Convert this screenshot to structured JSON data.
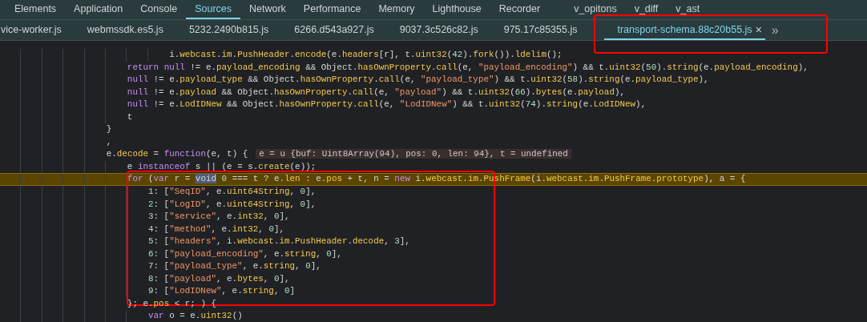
{
  "panel_tabs": [
    {
      "label": "Elements",
      "selected": false
    },
    {
      "label": "Application",
      "selected": false
    },
    {
      "label": "Console",
      "selected": false
    },
    {
      "label": "Sources",
      "selected": true
    },
    {
      "label": "Network",
      "selected": false
    },
    {
      "label": "Performance",
      "selected": false
    },
    {
      "label": "Memory",
      "selected": false
    },
    {
      "label": "Lighthouse",
      "selected": false
    },
    {
      "label": "Recorder",
      "selected": false
    },
    {
      "label": "v_opitons",
      "selected": false
    },
    {
      "label": "v_diff",
      "selected": false
    },
    {
      "label": "v_ast",
      "selected": false
    }
  ],
  "file_tabs": [
    {
      "label": "vice-worker.js",
      "selected": false,
      "annotated": false
    },
    {
      "label": "webmssdk.es5.js",
      "selected": false,
      "annotated": false
    },
    {
      "label": "5232.2490b815.js",
      "selected": false,
      "annotated": false
    },
    {
      "label": "6266.d543a927.js",
      "selected": false,
      "annotated": false
    },
    {
      "label": "9037.3c526c82.js",
      "selected": false,
      "annotated": false
    },
    {
      "label": "975.17c85355.js",
      "selected": false,
      "annotated": false
    },
    {
      "label": "transport-schema.88c20b55.js",
      "selected": true,
      "annotated": true,
      "close": "×"
    }
  ],
  "more_tabs": "»",
  "code_sections": [
    {
      "annotated": false,
      "lines": [
        {
          "text": "                                i.webcast.im.PushHeader.encode(e.headers[r], t.uint32(42).fork()).ldelim();"
        },
        {
          "text": "                        return null != e.payload_encoding && Object.hasOwnProperty.call(e, \"payload_encoding\") && t.uint32(50).string(e.payload_encoding),"
        },
        {
          "text": "                        null != e.payload_type && Object.hasOwnProperty.call(e, \"payload_type\") && t.uint32(58).string(e.payload_type),"
        },
        {
          "text": "                        null != e.payload && Object.hasOwnProperty.call(e, \"payload\") && t.uint32(66).bytes(e.payload),"
        },
        {
          "text": "                        null != e.LodIDNew && Object.hasOwnProperty.call(e, \"LodIDNew\") && t.uint32(74).string(e.LodIDNew),"
        },
        {
          "text": "                        t"
        },
        {
          "text": "                    }"
        },
        {
          "text": "                    ,"
        },
        {
          "text": "                    e.decode = function(e, t) {",
          "inline_value": "e = u {buf: Uint8Array(94), pos: 0, len: 94}, t = undefined"
        },
        {
          "text": "                        e instanceof s || (e = s.create(e));"
        }
      ]
    },
    {
      "annotated": true,
      "lines": [
        {
          "before": "                        for (var r = ",
          "selected_text": "void",
          "after": " 0 === t ? e.len : e.pos + t, n = new i.webcast.im.PushFrame(i.webcast.im.PushFrame.prototype), a = {",
          "paused": true
        },
        {
          "text": "                            1: [\"SeqID\", e.uint64String, 0],"
        },
        {
          "text": "                            2: [\"LogID\", e.uint64String, 0],"
        },
        {
          "text": "                            3: [\"service\", e.int32, 0],"
        },
        {
          "text": "                            4: [\"method\", e.int32, 0],"
        },
        {
          "text": "                            5: [\"headers\", i.webcast.im.PushHeader.decode, 3],"
        },
        {
          "text": "                            6: [\"payload_encoding\", e.string, 0],"
        },
        {
          "text": "                            7: [\"payload_type\", e.string, 0],"
        },
        {
          "text": "                            8: [\"payload\", e.bytes, 0],"
        },
        {
          "text": "                            9: [\"LodIDNew\", e.string, 0]"
        }
      ]
    },
    {
      "annotated": false,
      "lines": [
        {
          "text": "                        }; e.pos < r; ) {"
        },
        {
          "text": "                            var o = e.uint32()"
        }
      ]
    }
  ]
}
